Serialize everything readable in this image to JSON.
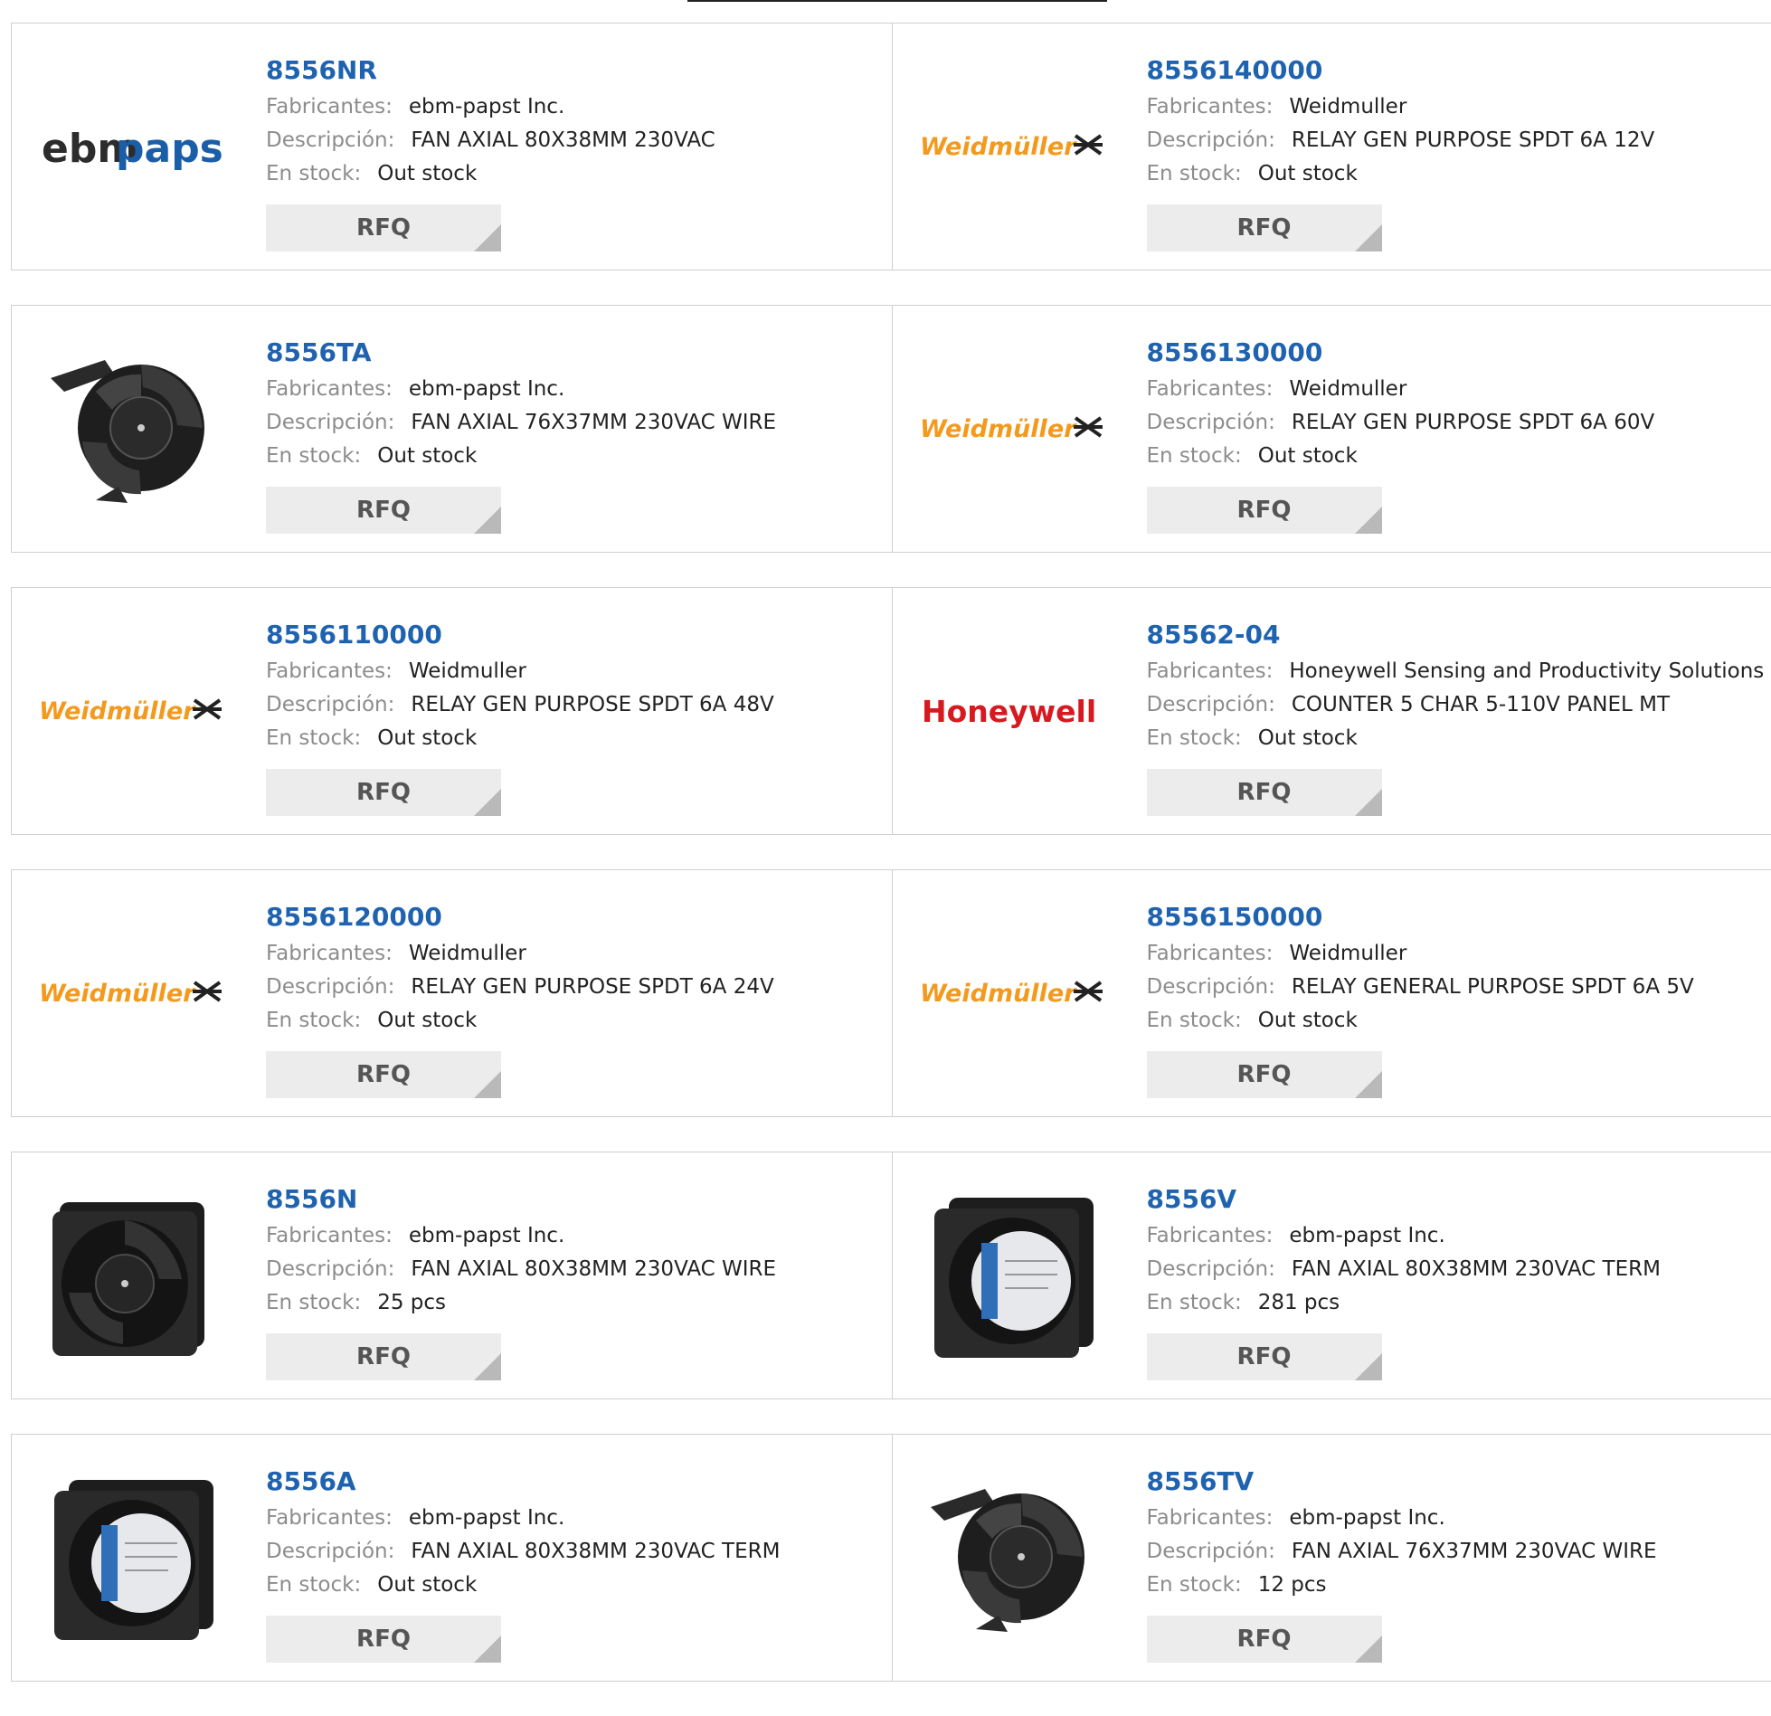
{
  "labels": {
    "mfr": "Fabricantes:",
    "desc": "Descripción:",
    "stock": "En stock:",
    "rfq": "RFQ"
  },
  "logos": {
    "ebmpapst_a": "ebm",
    "ebmpapst_b": "papst",
    "weidmuller": "Weidmüller",
    "honeywell": "Honeywell"
  },
  "colors": {
    "link": "#1f63b0",
    "weidmuller": "#f39a1e",
    "honeywell": "#d71920",
    "ebm_dark": "#2c2c2c",
    "ebm_blue": "#1b5ea8"
  },
  "products": [
    {
      "pn": "8556NR",
      "mfr": "ebm-papst Inc.",
      "desc": "FAN AXIAL 80X38MM 230VAC",
      "stock": "Out stock",
      "image": "ebmpapst-logo"
    },
    {
      "pn": "8556140000",
      "mfr": "Weidmuller",
      "desc": "RELAY GEN PURPOSE SPDT 6A 12V",
      "stock": "Out stock",
      "image": "weidmuller-logo"
    },
    {
      "pn": "8556TA",
      "mfr": "ebm-papst Inc.",
      "desc": "FAN AXIAL 76X37MM 230VAC WIRE",
      "stock": "Out stock",
      "image": "fan-bracket-photo"
    },
    {
      "pn": "8556130000",
      "mfr": "Weidmuller",
      "desc": "RELAY GEN PURPOSE SPDT 6A 60V",
      "stock": "Out stock",
      "image": "weidmuller-logo"
    },
    {
      "pn": "8556110000",
      "mfr": "Weidmuller",
      "desc": "RELAY GEN PURPOSE SPDT 6A 48V",
      "stock": "Out stock",
      "image": "weidmuller-logo"
    },
    {
      "pn": "85562-04",
      "mfr": "Honeywell Sensing and Productivity Solutions",
      "desc": "COUNTER 5 CHAR 5-110V PANEL MT",
      "stock": "Out stock",
      "image": "honeywell-logo"
    },
    {
      "pn": "8556120000",
      "mfr": "Weidmuller",
      "desc": "RELAY GEN PURPOSE SPDT 6A 24V",
      "stock": "Out stock",
      "image": "weidmuller-logo"
    },
    {
      "pn": "8556150000",
      "mfr": "Weidmuller",
      "desc": "RELAY GENERAL PURPOSE SPDT 6A 5V",
      "stock": "Out stock",
      "image": "weidmuller-logo"
    },
    {
      "pn": "8556N",
      "mfr": "ebm-papst Inc.",
      "desc": "FAN AXIAL 80X38MM 230VAC WIRE",
      "stock": "25 pcs",
      "image": "square-fan-photo"
    },
    {
      "pn": "8556V",
      "mfr": "ebm-papst Inc.",
      "desc": "FAN AXIAL 80X38MM 230VAC TERM",
      "stock": "281 pcs",
      "image": "square-fan-label-photo"
    },
    {
      "pn": "8556A",
      "mfr": "ebm-papst Inc.",
      "desc": "FAN AXIAL 80X38MM 230VAC TERM",
      "stock": "Out stock",
      "image": "square-fan-label-photo"
    },
    {
      "pn": "8556TV",
      "mfr": "ebm-papst Inc.",
      "desc": "FAN AXIAL 76X37MM 230VAC WIRE",
      "stock": "12 pcs",
      "image": "fan-bracket-photo"
    }
  ]
}
